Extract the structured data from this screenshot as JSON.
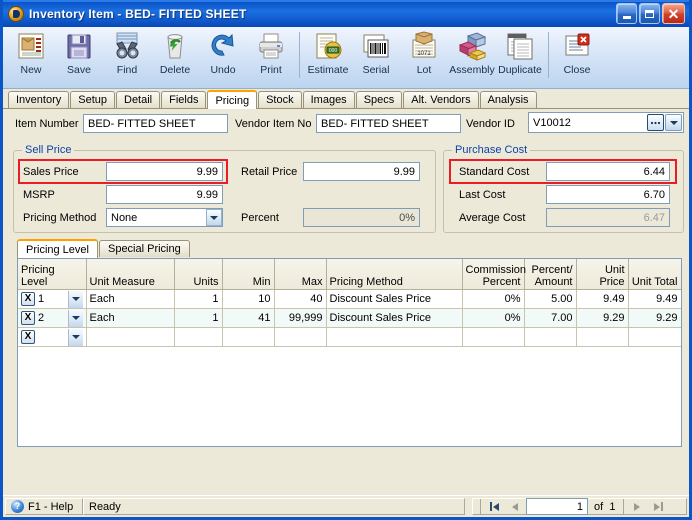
{
  "window": {
    "title": "Inventory Item - BED- FITTED SHEET",
    "icon": "app-globe-icon",
    "minimize_label": "Minimize",
    "maximize_label": "Maximize",
    "close_label": "Close"
  },
  "toolbar": {
    "buttons": [
      {
        "label": "New",
        "icon": "new-document-icon"
      },
      {
        "label": "Save",
        "icon": "floppy-disk-icon"
      },
      {
        "label": "Find",
        "icon": "binoculars-icon"
      },
      {
        "label": "Delete",
        "icon": "trash-recycle-icon"
      },
      {
        "label": "Undo",
        "icon": "undo-arrow-icon"
      },
      {
        "label": "Print",
        "icon": "printer-icon"
      },
      {
        "label": "Estimate",
        "icon": "estimate-money-icon"
      },
      {
        "label": "Serial",
        "icon": "barcode-serial-icon"
      },
      {
        "label": "Lot",
        "icon": "lot-box-icon"
      },
      {
        "label": "Assembly",
        "icon": "assembly-blocks-icon"
      },
      {
        "label": "Duplicate",
        "icon": "duplicate-pages-icon"
      },
      {
        "label": "Close",
        "icon": "close-window-icon"
      }
    ]
  },
  "tabs": {
    "items": [
      {
        "label": "Inventory",
        "active": false
      },
      {
        "label": "Setup",
        "active": false
      },
      {
        "label": "Detail",
        "active": false
      },
      {
        "label": "Fields",
        "active": false
      },
      {
        "label": "Pricing",
        "active": true
      },
      {
        "label": "Stock",
        "active": false
      },
      {
        "label": "Images",
        "active": false
      },
      {
        "label": "Specs",
        "active": false
      },
      {
        "label": "Alt. Vendors",
        "active": false
      },
      {
        "label": "Analysis",
        "active": false
      }
    ]
  },
  "header_fields": {
    "item_number_label": "Item Number",
    "item_number_value": "BED- FITTED SHEET",
    "vendor_item_no_label": "Vendor Item No",
    "vendor_item_no_value": "BED- FITTED SHEET",
    "vendor_id_label": "Vendor ID",
    "vendor_id_value": "V10012",
    "ellipsis_label": "...",
    "dropdown_icon": "chevron-down-icon"
  },
  "sell_price": {
    "group_title": "Sell Price",
    "sales_price_label": "Sales Price",
    "sales_price_value": "9.99",
    "msrp_label": "MSRP",
    "msrp_value": "9.99",
    "pricing_method_label": "Pricing Method",
    "pricing_method_value": "None",
    "retail_price_label": "Retail Price",
    "retail_price_value": "9.99",
    "percent_label": "Percent",
    "percent_value": "0%"
  },
  "purchase_cost": {
    "group_title": "Purchase Cost",
    "standard_cost_label": "Standard Cost",
    "standard_cost_value": "6.44",
    "last_cost_label": "Last Cost",
    "last_cost_value": "6.70",
    "average_cost_label": "Average Cost",
    "average_cost_value": "6.47"
  },
  "highlights": {
    "accent_color": "#ec1c24",
    "group_title_color": "#0a44a8",
    "active_tab_color": "#ffa200"
  },
  "inner_tabs": {
    "items": [
      {
        "label": "Pricing Level",
        "active": true
      },
      {
        "label": "Special Pricing",
        "active": false
      }
    ]
  },
  "grid": {
    "columns": [
      {
        "label": "Pricing\nLevel",
        "line1": "Pricing",
        "line2": "Level",
        "align": "left"
      },
      {
        "label": "Unit Measure",
        "line1": "",
        "line2": "Unit Measure",
        "align": "left"
      },
      {
        "label": "Units",
        "line1": "",
        "line2": "Units",
        "align": "right"
      },
      {
        "label": "Min",
        "line1": "",
        "line2": "Min",
        "align": "right"
      },
      {
        "label": "Max",
        "line1": "",
        "line2": "Max",
        "align": "right"
      },
      {
        "label": "Pricing Method",
        "line1": "",
        "line2": "Pricing Method",
        "align": "left"
      },
      {
        "label": "Commission Percent",
        "line1": "Commission",
        "line2": "Percent",
        "align": "right"
      },
      {
        "label": "Percent/ Amount",
        "line1": "Percent/",
        "line2": "Amount",
        "align": "right"
      },
      {
        "label": "Unit Price",
        "line1": "",
        "line2": "Unit Price",
        "align": "right"
      },
      {
        "label": "Unit Total",
        "line1": "",
        "line2": "Unit Total",
        "align": "right"
      }
    ],
    "delete_row_label": "X",
    "rows": [
      {
        "level": "1",
        "unit_measure": "Each",
        "units": "1",
        "min": "10",
        "max": "40",
        "pricing_method": "Discount Sales Price",
        "commission_percent": "0%",
        "percent_amount": "5.00",
        "unit_price": "9.49",
        "unit_total": "9.49"
      },
      {
        "level": "2",
        "unit_measure": "Each",
        "units": "1",
        "min": "41",
        "max": "99,999",
        "pricing_method": "Discount Sales Price",
        "commission_percent": "0%",
        "percent_amount": "7.00",
        "unit_price": "9.29",
        "unit_total": "9.29"
      },
      {
        "level": "",
        "unit_measure": "",
        "units": "",
        "min": "",
        "max": "",
        "pricing_method": "",
        "commission_percent": "",
        "percent_amount": "",
        "unit_price": "",
        "unit_total": ""
      }
    ]
  },
  "statusbar": {
    "help_icon": "question-mark-icon",
    "help_label": "F1 - Help",
    "status_label": "Ready",
    "first_icon": "first-record-icon",
    "prev_icon": "previous-record-icon",
    "record_value": "1",
    "of_label": "of",
    "total_records": "1",
    "next_icon": "next-record-icon",
    "last_icon": "last-record-icon"
  }
}
